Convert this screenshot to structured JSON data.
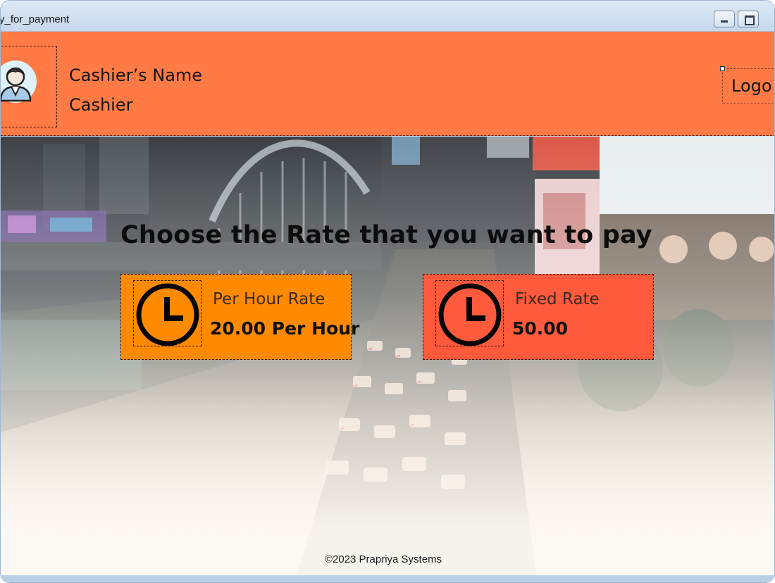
{
  "window": {
    "title": "y_for_payment",
    "controls": {
      "minimize_icon": "minimize-icon",
      "maximize_icon": "maximize-icon"
    }
  },
  "header": {
    "cashier_name": "Cashier’s Name",
    "cashier_role": "Cashier",
    "avatar_icon": "cashier-avatar-icon",
    "logout_label": "Logo",
    "background_color": "#ff7a45"
  },
  "main": {
    "prompt": "Choose the Rate that you want to pay",
    "rates": [
      {
        "title": "Per Hour Rate",
        "value": "20.00 Per Hour",
        "icon": "clock-icon",
        "color": "#ff8a00"
      },
      {
        "title": "Fixed Rate",
        "value": "50.00",
        "icon": "clock-icon",
        "color": "#ff5a3c"
      }
    ]
  },
  "footer": {
    "copyright": "©2023 Prapriya Systems"
  }
}
